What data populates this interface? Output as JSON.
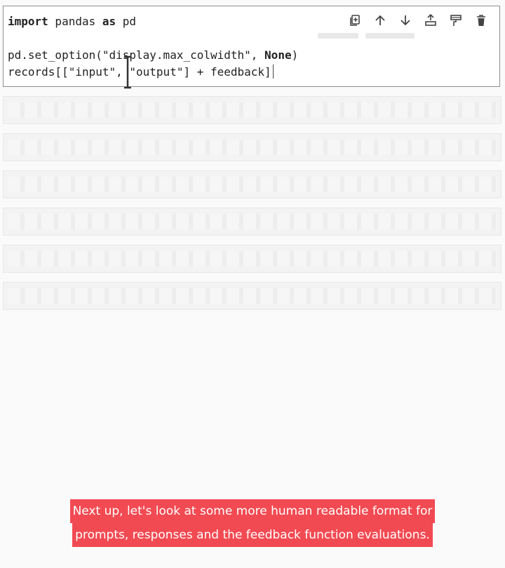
{
  "cell": {
    "lines": [
      {
        "kw1": "import",
        "t1": " pandas ",
        "kw2": "as",
        "t2": " pd"
      },
      {
        "text": ""
      },
      {
        "pre": "pd.set_option(\"display.max_colwidth\", ",
        "kw": "None",
        "post": ")"
      },
      {
        "text": "records[[\"input\", \"output\"] + feedback]"
      }
    ]
  },
  "toolbar": {
    "buttons": [
      {
        "name": "duplicate-cell-icon"
      },
      {
        "name": "move-up-icon"
      },
      {
        "name": "move-down-icon"
      },
      {
        "name": "insert-below-icon"
      },
      {
        "name": "format-cell-icon"
      },
      {
        "name": "delete-cell-icon"
      }
    ]
  },
  "outputs": {
    "count": 6
  },
  "caption": {
    "line1": "Next up, let's look at some more human readable format for",
    "line2": "prompts, responses and the feedback function evaluations."
  },
  "colors": {
    "caption_bg": "#f24a52",
    "caption_text": "#ffffff"
  }
}
